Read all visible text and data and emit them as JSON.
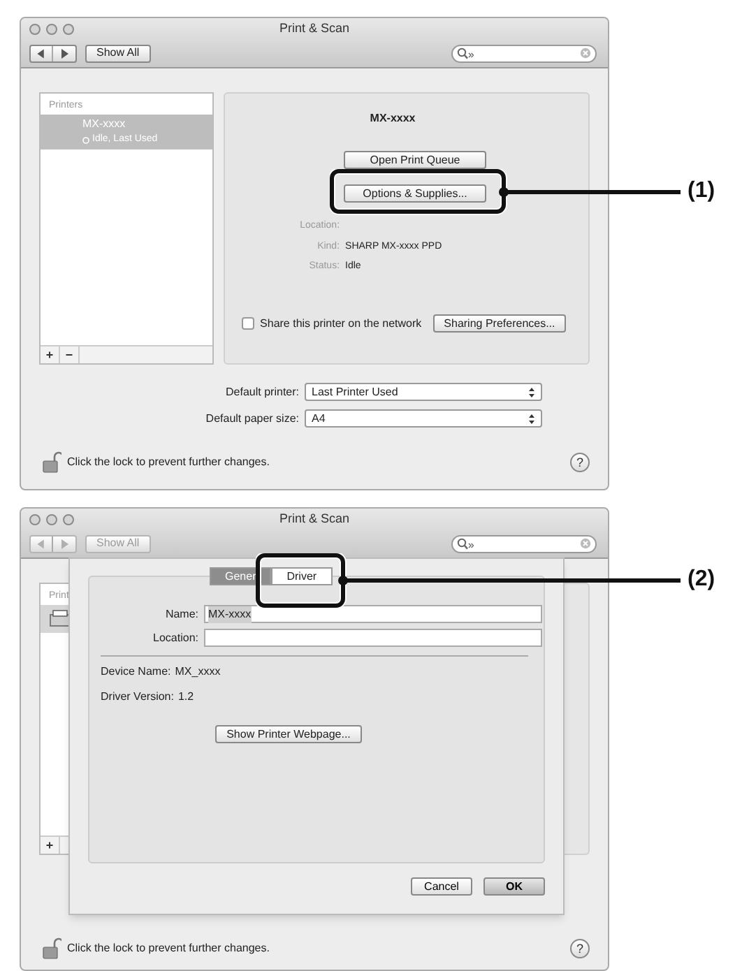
{
  "window_1": {
    "title": "Print & Scan",
    "nav_disabled": false,
    "show_all": "Show All",
    "printers": {
      "header": "Printers",
      "add": "+",
      "remove": "−",
      "items": [
        {
          "name": "MX-xxxx",
          "status": "Idle, Last Used",
          "selected": true
        }
      ]
    },
    "detail": {
      "name": "MX-xxxx",
      "buttons": [
        "Open Print Queue",
        "Options & Supplies..."
      ],
      "fields": [
        {
          "label": "Location:"
        },
        {
          "label": "Kind:",
          "value": "SHARP MX-xxxx PPD"
        },
        {
          "label": "Status:",
          "value": "Idle"
        }
      ],
      "share": {
        "label": "Share this printer on the network",
        "checked": false
      },
      "sharing_button": "Sharing Preferences..."
    },
    "defaults": [
      {
        "label": "Default printer:",
        "value": "Last Printer Used"
      },
      {
        "label": "Default paper size:",
        "value": "A4"
      }
    ],
    "lock_text": "Click the lock to prevent further changes.",
    "help": "?"
  },
  "window_2": {
    "title": "Print & Scan",
    "nav_disabled": true,
    "show_all": "Show All",
    "sidebar_header": "Print",
    "add": "+",
    "sheet": {
      "tabs": [
        {
          "label": "Gener",
          "selected": true
        },
        {
          "label": "Driver",
          "selected": false
        }
      ],
      "fields": [
        {
          "label": "Name:",
          "value": "MX-xxxx"
        },
        {
          "label": "Location:"
        }
      ],
      "info": [
        {
          "label": "Device Name:",
          "value": "MX_xxxx"
        },
        {
          "label": "Driver Version:",
          "value": "1.2"
        }
      ],
      "webpage_button": "Show Printer Webpage...",
      "buttons": [
        {
          "label": "Cancel",
          "default": false
        },
        {
          "label": "OK",
          "default": true
        }
      ]
    },
    "lock_text": "Click the lock to prevent further changes.",
    "help": "?"
  },
  "callouts": [
    {
      "label": "(1)"
    },
    {
      "label": "(2)"
    }
  ]
}
